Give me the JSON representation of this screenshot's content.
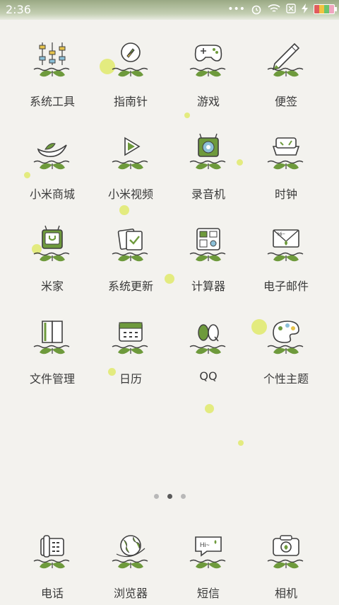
{
  "status_bar": {
    "time": "2:36",
    "icons": [
      "more-icon",
      "alarm-icon",
      "wifi-icon",
      "no-sim-icon",
      "charging-icon",
      "battery-icon"
    ]
  },
  "home": {
    "apps": [
      {
        "label": "系统工具",
        "icon": "tools-icon"
      },
      {
        "label": "指南针",
        "icon": "compass-icon"
      },
      {
        "label": "游戏",
        "icon": "gamepad-icon"
      },
      {
        "label": "便签",
        "icon": "notes-icon"
      },
      {
        "label": "小米商城",
        "icon": "mall-icon"
      },
      {
        "label": "小米视频",
        "icon": "video-icon"
      },
      {
        "label": "录音机",
        "icon": "recorder-icon"
      },
      {
        "label": "时钟",
        "icon": "clock-icon"
      },
      {
        "label": "米家",
        "icon": "mijia-icon"
      },
      {
        "label": "系统更新",
        "icon": "update-icon"
      },
      {
        "label": "计算器",
        "icon": "calculator-icon"
      },
      {
        "label": "电子邮件",
        "icon": "email-icon"
      },
      {
        "label": "文件管理",
        "icon": "file-manager-icon"
      },
      {
        "label": "日历",
        "icon": "calendar-icon"
      },
      {
        "label": "QQ",
        "icon": "qq-icon"
      },
      {
        "label": "个性主题",
        "icon": "themes-icon"
      }
    ]
  },
  "pager": {
    "pages": 3,
    "current": 2
  },
  "dock": {
    "apps": [
      {
        "label": "电话",
        "icon": "phone-icon"
      },
      {
        "label": "浏览器",
        "icon": "browser-icon"
      },
      {
        "label": "短信",
        "icon": "messages-icon"
      },
      {
        "label": "相机",
        "icon": "camera-icon"
      }
    ]
  },
  "colors": {
    "accent_green": "#6e9a3c",
    "sprout": "#5f8d2e",
    "blob": "#dde85a",
    "bg": "#f3f2ee"
  }
}
